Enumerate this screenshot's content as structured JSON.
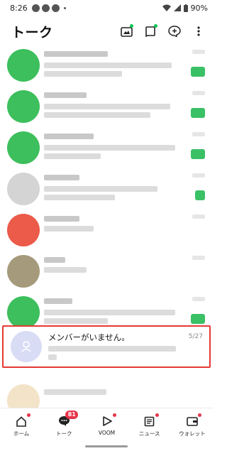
{
  "status_bar": {
    "time": "8:26",
    "battery": "90%"
  },
  "header": {
    "title": "トーク",
    "actions": [
      "photo-album-icon",
      "chat-bubble-icon",
      "add-chat-icon",
      "more-vert-icon"
    ]
  },
  "colors": {
    "line_green": "#06c755",
    "highlight_red": "#e53935",
    "badge_red": "#e8334a"
  },
  "chats": {
    "highlighted": {
      "name": "メンバーがいません。",
      "date": "5/27"
    }
  },
  "bottom_nav": {
    "home": "ホーム",
    "talk": "トーク",
    "talk_badge": "81",
    "voom": "VOOM",
    "news": "ニュース",
    "wallet": "ウォレット"
  }
}
